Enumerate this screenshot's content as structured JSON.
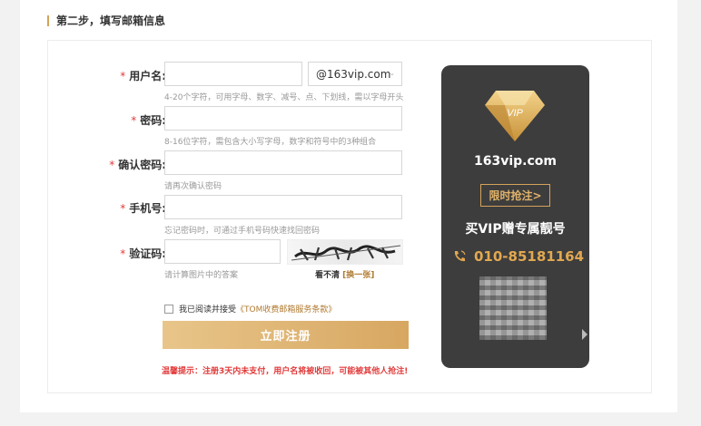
{
  "section": {
    "title": "第二步，填写邮箱信息"
  },
  "form": {
    "required_mark": "*",
    "username": {
      "label": "用户名:",
      "value": "",
      "hint": "4-20个字符，可用字母、数字、减号、点、下划线，需以字母开头"
    },
    "domain": {
      "selected": "@163vip.com"
    },
    "password": {
      "label": "密码:",
      "value": "",
      "hint": "8-16位字符，需包含大小写字母，数字和符号中的3种组合"
    },
    "confirm": {
      "label": "确认密码:",
      "value": "",
      "hint": "请再次确认密码"
    },
    "phone": {
      "label": "手机号:",
      "value": "",
      "hint": "忘记密码时，可通过手机号码快速找回密码"
    },
    "captcha": {
      "label": "验证码:",
      "value": "",
      "hint": "请计算图片中的答案",
      "refresh_prefix": "看不清 ",
      "refresh_link": "[换一张]"
    },
    "agree": {
      "text": "我已阅读并接受",
      "terms": "《TOM收费邮箱服务条款》"
    },
    "submit_label": "立即注册",
    "warning": "温馨提示：注册3天内未支付，用户名将被收回，可能被其他人抢注!"
  },
  "vip_panel": {
    "badge_text": "VIP",
    "site": "163vip.com",
    "rush_label": "限时抢注>",
    "slogan": "买VIP赠专属靓号",
    "phone": "010-85181164"
  },
  "colors": {
    "accent": "#d4a35a",
    "warning": "#e23b3b",
    "panel_bg": "#3d3d3d"
  }
}
